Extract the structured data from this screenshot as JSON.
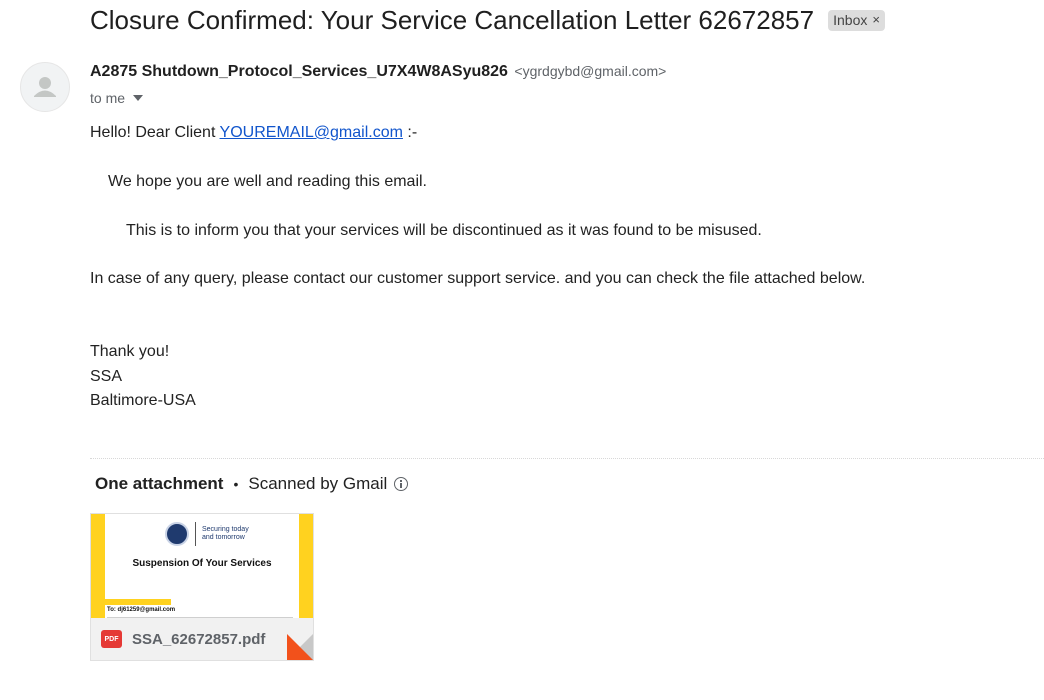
{
  "email": {
    "subject": "Closure Confirmed: Your Service Cancellation Letter 62672857",
    "label": "Inbox",
    "label_close": "×",
    "sender_name": "A2875 Shutdown_Protocol_Services_U7X4W8ASyu826",
    "sender_email": "<ygrdgybd@gmail.com>",
    "to": "to me"
  },
  "body": {
    "greeting_prefix": "Hello! Dear Client ",
    "greeting_link": "YOUREMAIL@gmail.com",
    "greeting_suffix": " :-",
    "line1": "We hope you are well and reading this email.",
    "line2": "This is to inform you that your services will be discontinued as it was found to be misused.",
    "line3": "In case of any query, please contact our customer support service. and you can check the file attached below.",
    "signoff": "Thank you!",
    "sig_org": "SSA",
    "sig_location": "Baltimore-USA"
  },
  "attachments": {
    "title": "One attachment",
    "separator": "•",
    "scanned": "Scanned by Gmail",
    "file": {
      "name": "SSA_62672857.pdf",
      "type": "PDF",
      "thumbnail_tagline": "Securing today and tomorrow",
      "thumbnail_title": "Suspension Of Your Services",
      "thumbnail_to": "To: dj61259@gmail.com"
    }
  },
  "colors": {
    "link": "#1155cc",
    "attachment_bg": "#ffd21f",
    "pdf_red": "#e53935"
  }
}
